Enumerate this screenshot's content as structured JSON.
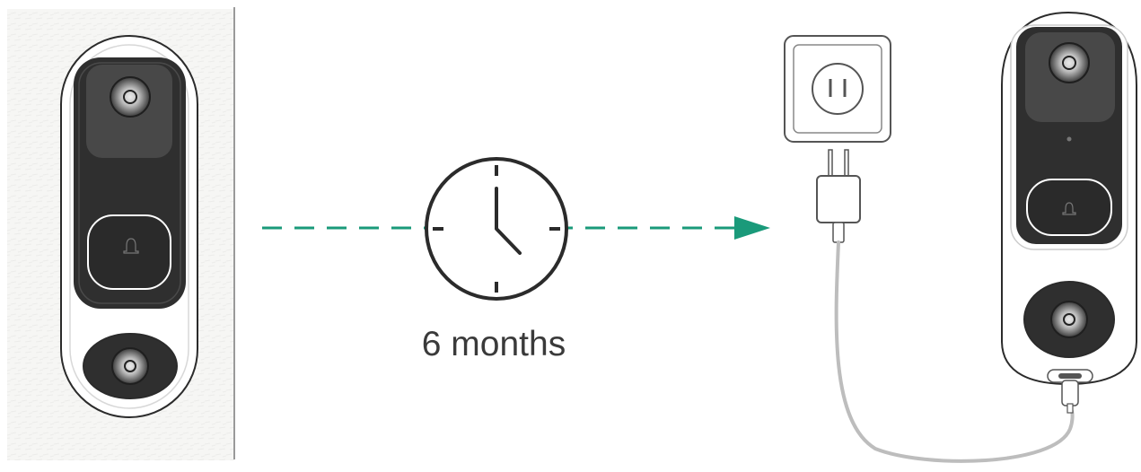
{
  "caption": "6 months",
  "colors": {
    "arrow": "#1a9a7a",
    "outline": "#2b2b2b",
    "device_black": "#2f2f2f",
    "device_body": "#ffffff",
    "cable": "#bdbdbd",
    "wall": "#f6f6f4"
  },
  "icons": [
    "doorbell-mounted-icon",
    "clock-icon",
    "wall-outlet-icon",
    "power-adapter-icon",
    "doorbell-charging-icon"
  ]
}
